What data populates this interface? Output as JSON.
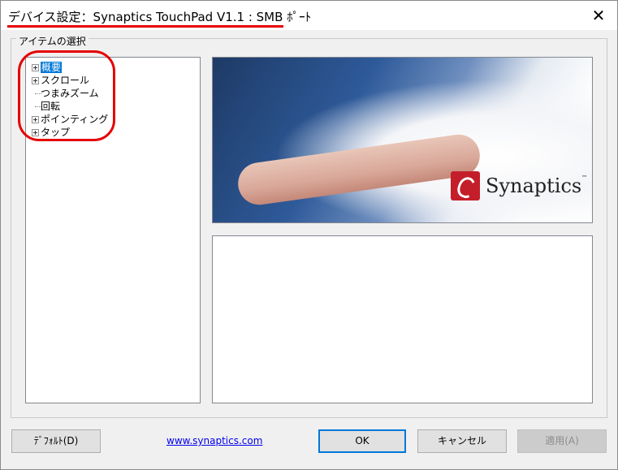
{
  "window": {
    "title": "デバイス設定：Synaptics TouchPad V1.1 : SMB ﾎﾟｰﾄ",
    "close_glyph": "✕"
  },
  "group": {
    "label": "アイテムの選択"
  },
  "tree": {
    "items": [
      {
        "label": "概要",
        "expandable": true,
        "selected": true
      },
      {
        "label": "スクロール",
        "expandable": true,
        "selected": false
      },
      {
        "label": "つまみズーム",
        "expandable": false,
        "selected": false
      },
      {
        "label": "回転",
        "expandable": false,
        "selected": false
      },
      {
        "label": "ポインティング",
        "expandable": true,
        "selected": false
      },
      {
        "label": "タップ",
        "expandable": true,
        "selected": false
      }
    ]
  },
  "banner": {
    "brand": "Synaptics",
    "tm": "™"
  },
  "buttons": {
    "default_label": "ﾃﾞﾌｫﾙﾄ(D)",
    "ok_label": "OK",
    "cancel_label": "キャンセル",
    "apply_label": "適用(A)"
  },
  "link": {
    "text": "www.synaptics.com"
  },
  "colors": {
    "annotation_red": "#e60000",
    "selection_blue": "#0078d7",
    "brand_red": "#c41e2a"
  }
}
